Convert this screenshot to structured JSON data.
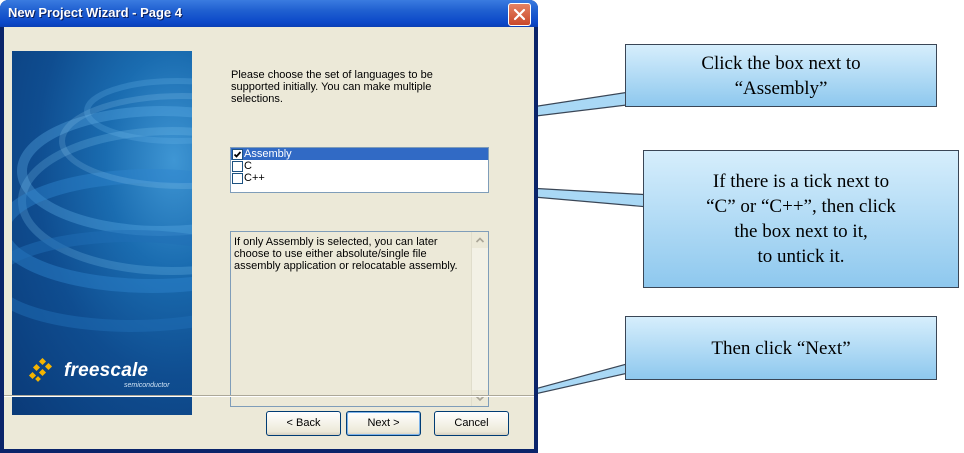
{
  "window": {
    "title": "New Project Wizard - Page  4"
  },
  "banner": {
    "logo_text": "freescale",
    "logo_sub": "semiconductor"
  },
  "wizard": {
    "instruction": "Please choose the set of languages to be supported initially. You can make multiple selections.",
    "languages": [
      {
        "label": "Assembly",
        "checked": true,
        "selected": true
      },
      {
        "label": "C",
        "checked": false,
        "selected": false
      },
      {
        "label": "C++",
        "checked": false,
        "selected": false
      }
    ],
    "description": "If only Assembly is selected, you can later choose to use either absolute/single file assembly application or relocatable assembly."
  },
  "buttons": {
    "back": "< Back",
    "next": "Next >",
    "cancel": "Cancel"
  },
  "callouts": {
    "assembly": [
      "Click the box next to",
      "“Assembly”"
    ],
    "untick": [
      "If there is a tick next to",
      "“C” or “C++”, then click",
      "the box next to it,",
      "to untick it."
    ],
    "next": "Then click “Next”"
  },
  "colors": {
    "title_bar": "#0b47c8",
    "selection": "#316ac5",
    "callout_fill": "#a9d8f5"
  }
}
